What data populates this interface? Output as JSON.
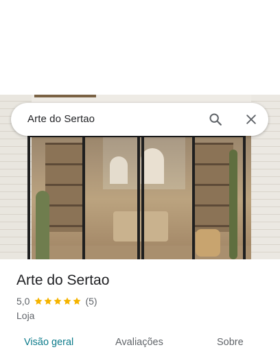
{
  "search": {
    "query": "Arte do Sertao",
    "search_icon": "search-icon",
    "close_icon": "close-icon"
  },
  "place": {
    "name": "Arte do Sertao",
    "rating": "5,0",
    "stars": 5,
    "reviews": "(5)",
    "category": "Loja"
  },
  "tabs": [
    {
      "label": "Visão geral",
      "active": true
    },
    {
      "label": "Avaliações",
      "active": false
    },
    {
      "label": "Sobre",
      "active": false
    }
  ],
  "colors": {
    "accent": "#0b7a8a",
    "star": "#f5b400",
    "text": "#202124",
    "secondary": "#5f6368"
  }
}
